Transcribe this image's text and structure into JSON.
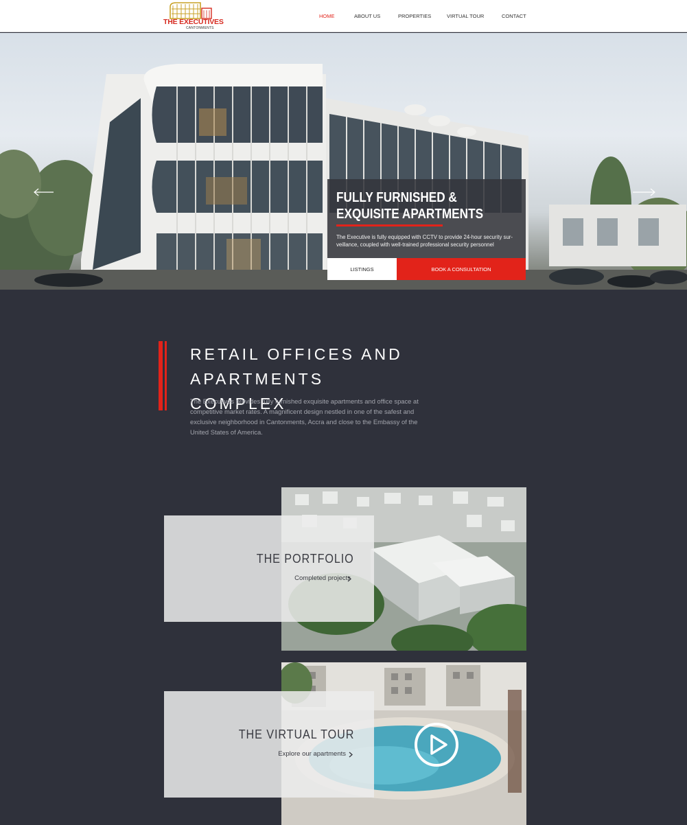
{
  "brand": {
    "name": "THE EXECUTIVES",
    "subtitle": "CANTONMENTS"
  },
  "nav": {
    "items": [
      {
        "label": "HOME",
        "active": true
      },
      {
        "label": "ABOUT US",
        "active": false
      },
      {
        "label": "PROPERTIES",
        "active": false
      },
      {
        "label": "VIRTUAL TOUR",
        "active": false
      },
      {
        "label": "CONTACT",
        "active": false
      }
    ]
  },
  "hero": {
    "title_line1": "FULLY FURNISHED &",
    "title_line2": "EXQUISITE APARTMENTS",
    "text": "The Executive is fully equipped with CCTV to provide 24-hour security sur-veillance, coupled with well-trained professional security personnel",
    "listings_label": "LISTINGS",
    "consult_label": "BOOK A CONSULTATION",
    "prev_icon": "arrow-left-icon",
    "next_icon": "arrow-right-icon"
  },
  "intro": {
    "title_line1": "RETAIL OFFICES AND",
    "title_line2": "APARTMENTS COMPLEX",
    "text": "The Executives provides fully furnished exquisite apartments and office space at competitive market rates. A magnificent design nestled in one of the safest and exclusive neighborhood in Cantonments, Accra and close to the Embassy of the United States of America."
  },
  "cards": [
    {
      "title": "THE PORTFOLIO",
      "link": "Completed projects",
      "icon": "chevron-right-icon"
    },
    {
      "title": "THE VIRTUAL TOUR",
      "link": "Explore our apartments",
      "icon": "chevron-right-icon",
      "media_icon": "play-icon"
    }
  ],
  "colors": {
    "accent": "#e2231a",
    "background": "#2f313b",
    "header": "#ffffff",
    "panel": "#ececec"
  }
}
